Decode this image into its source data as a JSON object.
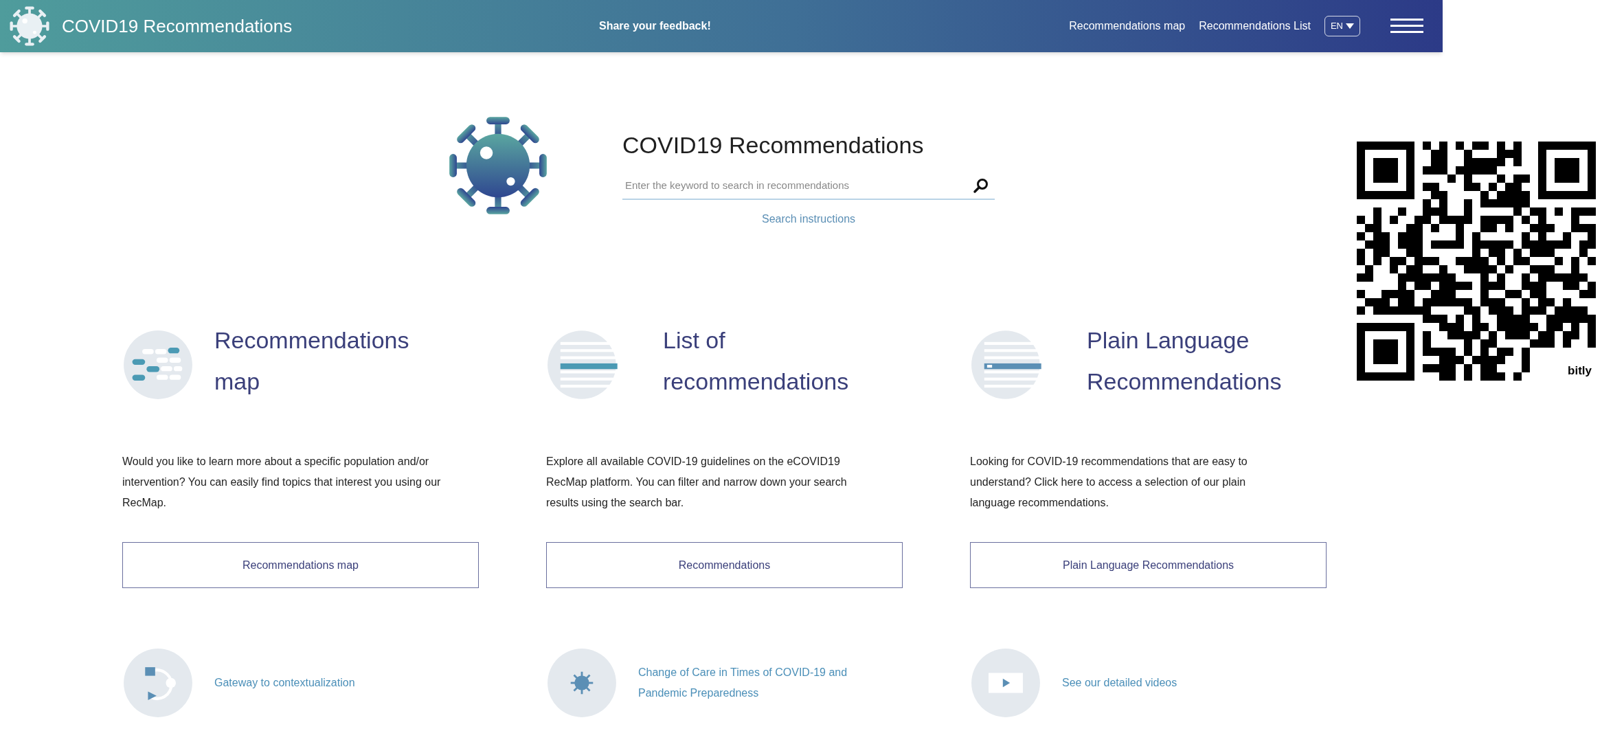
{
  "header": {
    "title": "COVID19 Recommendations",
    "feedback_link": "Share your feedback!",
    "nav_links": [
      "Recommendations map",
      "Recommendations List"
    ],
    "language": "EN"
  },
  "hero": {
    "title": "COVID19 Recommendations",
    "search": {
      "placeholder": "Enter the keyword to search in recommendations"
    },
    "search_instructions": "Search instructions"
  },
  "qr_code": {
    "label": "bitly"
  },
  "cards": [
    {
      "kind": "map",
      "title": "Recommendations map",
      "description": "Would you like to learn more about a specific population and/or intervention? You can easily find topics that interest you using our RecMap.",
      "button": "Recommendations map"
    },
    {
      "kind": "list",
      "title": "List of recommendations",
      "description": "Explore all available COVID-19 guidelines on the eCOVID19 RecMap platform. You can filter and narrow down your search results using the search bar.",
      "button": "Recommendations"
    },
    {
      "kind": "plain",
      "title": "Plain Language Recommendations",
      "description": "Looking for COVID-19 recommendations that are easy to understand? Click here to access a selection of our plain language recommendations.",
      "button": "Plain Language Recommendations"
    }
  ],
  "links": [
    {
      "kind": "gateway",
      "label": "Gateway to contextualization"
    },
    {
      "kind": "virus",
      "label": "Change of Care in Times of COVID-19 and Pandemic Preparedness"
    },
    {
      "kind": "video",
      "label": "See our detailed videos"
    }
  ]
}
